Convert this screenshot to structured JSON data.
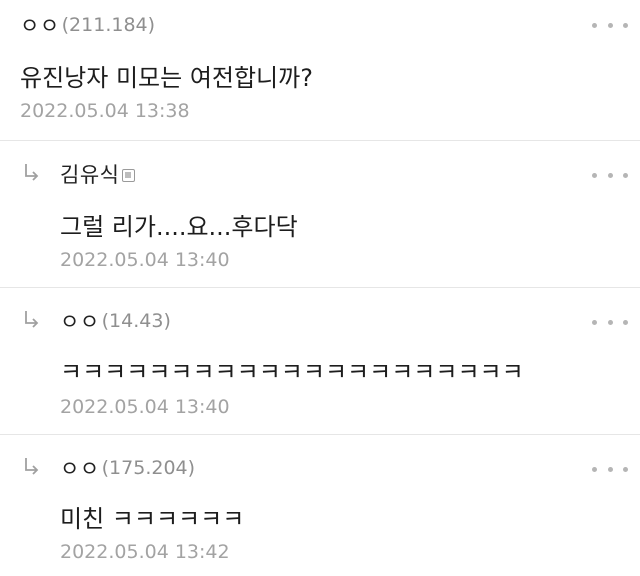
{
  "comments": [
    {
      "author": "ㅇㅇ",
      "ip": "(211.184)",
      "text": "유진낭자 미모는 여전합니까?",
      "time": "2022.05.04 13:38",
      "is_reply": false
    },
    {
      "author": "김유식",
      "ip": "",
      "text": "그럴 리가....요...후다닥",
      "time": "2022.05.04 13:40",
      "is_reply": true,
      "badge_icon": "member-badge-icon"
    },
    {
      "author": "ㅇㅇ",
      "ip": "(14.43)",
      "text": "ㅋㅋㅋㅋㅋㅋㅋㅋㅋㅋㅋㅋㅋㅋㅋㅋㅋㅋㅋㅋㅋ",
      "time": "2022.05.04 13:40",
      "is_reply": true
    },
    {
      "author": "ㅇㅇ",
      "ip": "(175.204)",
      "text": "미친 ㅋㅋㅋㅋㅋㅋ",
      "time": "2022.05.04 13:42",
      "is_reply": true
    }
  ],
  "icons": {
    "reply": "reply-arrow-icon",
    "more": "more-options-icon"
  },
  "colors": {
    "author": "#222222",
    "ip": "#8f8f8f",
    "time": "#a3a3a3",
    "divider": "#e6e6e6",
    "dots": "#b5b5b5"
  }
}
